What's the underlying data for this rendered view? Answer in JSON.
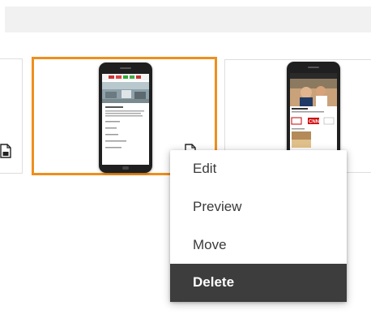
{
  "context_menu": {
    "items": [
      {
        "label": "Edit",
        "active": false
      },
      {
        "label": "Preview",
        "active": false
      },
      {
        "label": "Move",
        "active": false
      },
      {
        "label": "Delete",
        "active": true
      }
    ]
  },
  "colors": {
    "selection_border": "#ef8f1c",
    "active_item_bg": "#3d3d3d",
    "cnn_red": "#cc0000"
  },
  "thumbnails": {
    "right_logo": "CNN"
  },
  "icons": [
    "document-icon",
    "phone-mockup"
  ]
}
